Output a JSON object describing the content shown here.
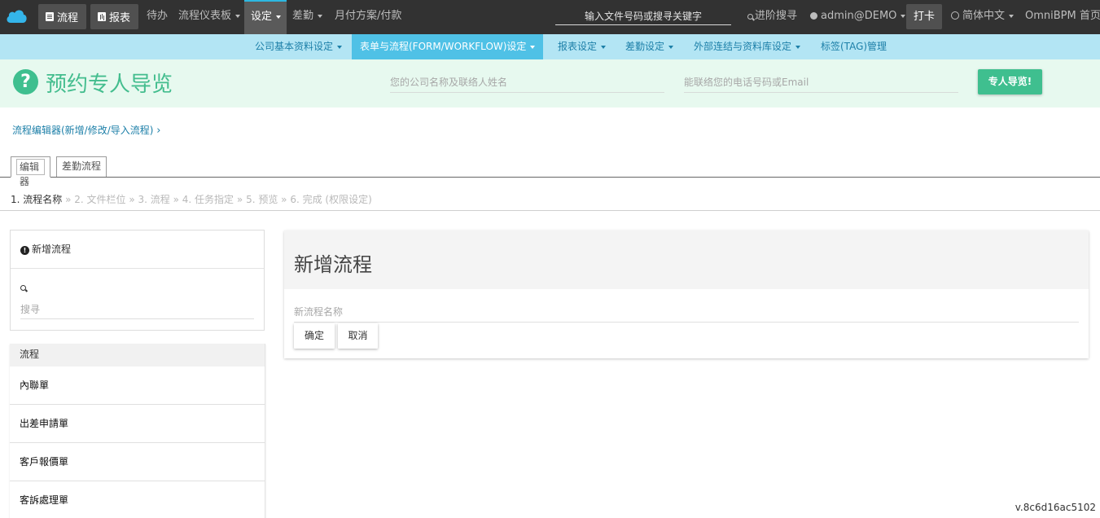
{
  "topbar": {
    "logo_icon": "cloud-icon",
    "flow_btn": "流程",
    "report_btn": "报表",
    "todo": "待办",
    "dashboard": "流程仪表板",
    "settings": "设定",
    "attendance": "差勤",
    "monthly_plan": "月付方案/付款",
    "search_placeholder": "输入文件号码或搜寻关键字",
    "advanced_search": "进阶搜寻",
    "user": "admin@DEMO",
    "punch": "打卡",
    "language": "简体中文",
    "home": "OmniBPM 首页",
    "accent_color": "#2db7e0"
  },
  "subnav": {
    "items": [
      {
        "label": "公司基本资料设定",
        "caret": true
      },
      {
        "label": "表单与流程(FORM/WORKFLOW)设定",
        "caret": true,
        "active": true
      },
      {
        "label": "报表设定",
        "caret": true
      },
      {
        "label": "差勤设定",
        "caret": true
      },
      {
        "label": "外部连结与资料库设定",
        "caret": true
      },
      {
        "label": "标签(TAG)管理",
        "caret": false
      }
    ]
  },
  "tour": {
    "title": "预约专人导览",
    "company_placeholder": "您的公司名称及联络人姓名",
    "contact_placeholder": "能联络您的电话号码或Email",
    "button": "专人导览!",
    "accent_color": "#3fbf8f"
  },
  "breadcrumb": "流程编辑器(新增/修改/导入流程)",
  "tabs": [
    "编辑器",
    "差勤流程"
  ],
  "steps": {
    "current": "1. 流程名称",
    "rest": [
      "2. 文件栏位",
      "3. 流程",
      "4. 任务指定",
      "5. 预览",
      "6. 完成 (权限设定)"
    ],
    "separator": "»"
  },
  "left_panel": {
    "new_flow": "新增流程",
    "search_placeholder": "搜寻",
    "list_header": "流程",
    "items": [
      "內聯單",
      "出差申請單",
      "客戶報價單",
      "客訴處理單"
    ]
  },
  "card": {
    "title": "新增流程",
    "name_placeholder": "新流程名称",
    "confirm": "确定",
    "cancel": "取消"
  },
  "version": "v.8c6d16ac5102"
}
